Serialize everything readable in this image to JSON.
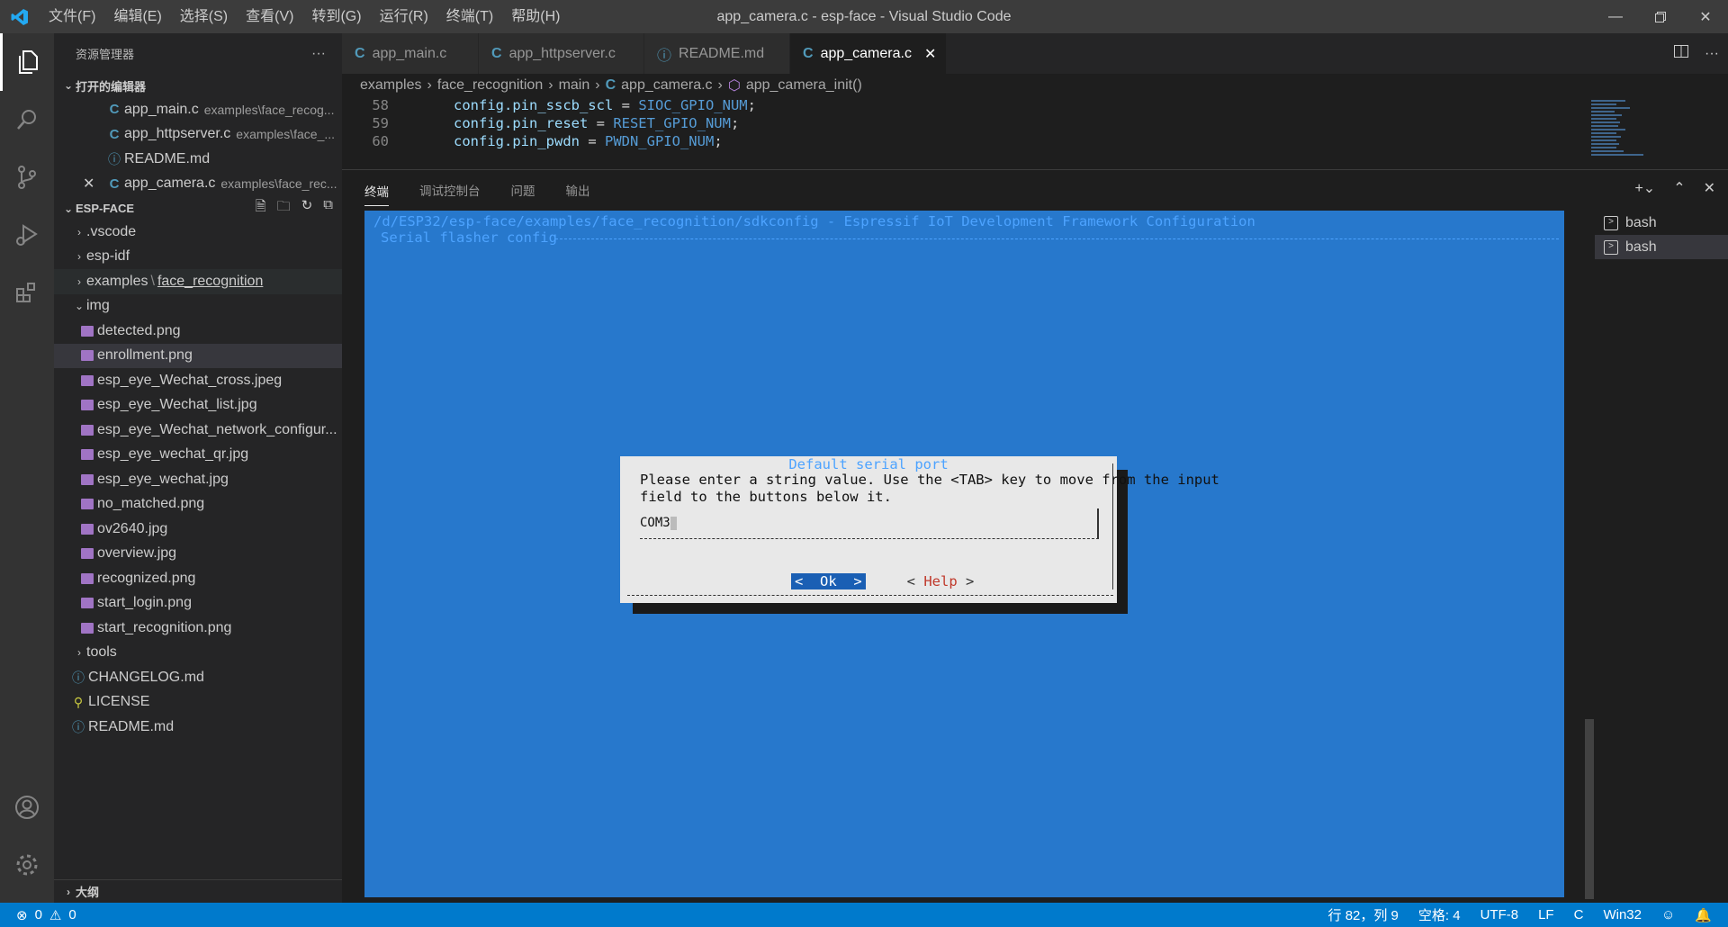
{
  "window": {
    "title": "app_camera.c - esp-face - Visual Studio Code"
  },
  "menu": [
    "文件(F)",
    "编辑(E)",
    "选择(S)",
    "查看(V)",
    "转到(G)",
    "运行(R)",
    "终端(T)",
    "帮助(H)"
  ],
  "sidebar": {
    "header": "资源管理器",
    "open_editors_title": "打开的编辑器",
    "open_editors": [
      {
        "name": "app_main.c",
        "desc": "examples\\face_recog..."
      },
      {
        "name": "app_httpserver.c",
        "desc": "examples\\face_..."
      },
      {
        "name": "README.md",
        "desc": ""
      },
      {
        "name": "app_camera.c",
        "desc": "examples\\face_rec..."
      }
    ],
    "workspace_title": "ESP-FACE",
    "tree": {
      "vscode": ".vscode",
      "espidf": "esp-idf",
      "examples": "examples",
      "face_recognition": "face_recognition",
      "img": "img",
      "img_files": [
        "detected.png",
        "enrollment.png",
        "esp_eye_Wechat_cross.jpeg",
        "esp_eye_Wechat_list.jpg",
        "esp_eye_Wechat_network_configur...",
        "esp_eye_wechat_qr.jpg",
        "esp_eye_wechat.jpg",
        "no_matched.png",
        "ov2640.jpg",
        "overview.jpg",
        "recognized.png",
        "start_login.png",
        "start_recognition.png"
      ],
      "tools": "tools",
      "changelog": "CHANGELOG.md",
      "license": "LICENSE",
      "readme": "README.md"
    },
    "outline_title": "大纲"
  },
  "tabs": [
    {
      "label": "app_main.c"
    },
    {
      "label": "app_httpserver.c"
    },
    {
      "label": "README.md"
    },
    {
      "label": "app_camera.c"
    }
  ],
  "breadcrumb": [
    "examples",
    "face_recognition",
    "main",
    "app_camera.c",
    "app_camera_init()"
  ],
  "code": [
    {
      "ln": "58",
      "field": "config.pin_sscb_scl",
      "val": "SIOC_GPIO_NUM"
    },
    {
      "ln": "59",
      "field": "config.pin_reset",
      "val": "RESET_GPIO_NUM"
    },
    {
      "ln": "60",
      "field": "config.pin_pwdn",
      "val": "PWDN_GPIO_NUM"
    }
  ],
  "panel": {
    "tabs": [
      "终端",
      "调试控制台",
      "问题",
      "输出"
    ],
    "terminal": {
      "path": "/d/ESP32/esp-face/examples/face_recognition/sdkconfig - Espressif IoT Development Framework Configuration",
      "section": "Serial flasher config",
      "dialog": {
        "title": "Default serial port",
        "text": "Please enter a string value. Use the <TAB> key to move from the input\nfield to the buttons below it.",
        "value": "COM3",
        "ok": "Ok",
        "help": "Help"
      }
    },
    "terminals": [
      "bash",
      "bash"
    ]
  },
  "status": {
    "errors": "0",
    "warnings": "0",
    "position": "行 82，列 9",
    "spaces": "空格: 4",
    "encoding": "UTF-8",
    "eol": "LF",
    "language": "C",
    "platform": "Win32"
  }
}
